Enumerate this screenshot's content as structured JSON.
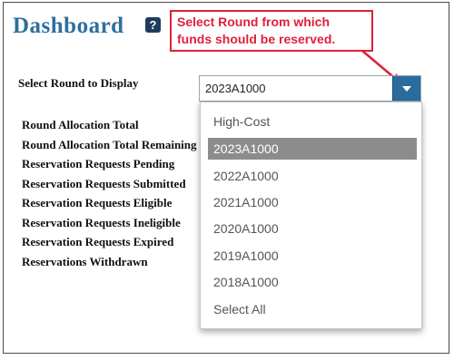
{
  "header": {
    "title": "Dashboard",
    "help_label": "?",
    "callout_text": "Select Round from which funds should be reserved."
  },
  "round_select": {
    "label": "Select Round to Display",
    "value": "2023A1000",
    "options": [
      {
        "label": "High-Cost",
        "selected": false
      },
      {
        "label": "2023A1000",
        "selected": true
      },
      {
        "label": "2022A1000",
        "selected": false
      },
      {
        "label": "2021A1000",
        "selected": false
      },
      {
        "label": "2020A1000",
        "selected": false
      },
      {
        "label": "2019A1000",
        "selected": false
      },
      {
        "label": "2018A1000",
        "selected": false
      },
      {
        "label": "Select All",
        "selected": false
      }
    ]
  },
  "stats": [
    "Round Allocation Total",
    "Round Allocation Total Remaining",
    "Reservation Requests Pending",
    "Reservation Requests Submitted",
    "Reservation Requests Eligible",
    "Reservation Requests Ineligible",
    "Reservation Requests Expired",
    "Reservations Withdrawn"
  ],
  "colors": {
    "title": "#2e6f9e",
    "callout": "#e0203a",
    "select_button": "#2b6c9e",
    "selected_option": "#8c8c8c"
  }
}
